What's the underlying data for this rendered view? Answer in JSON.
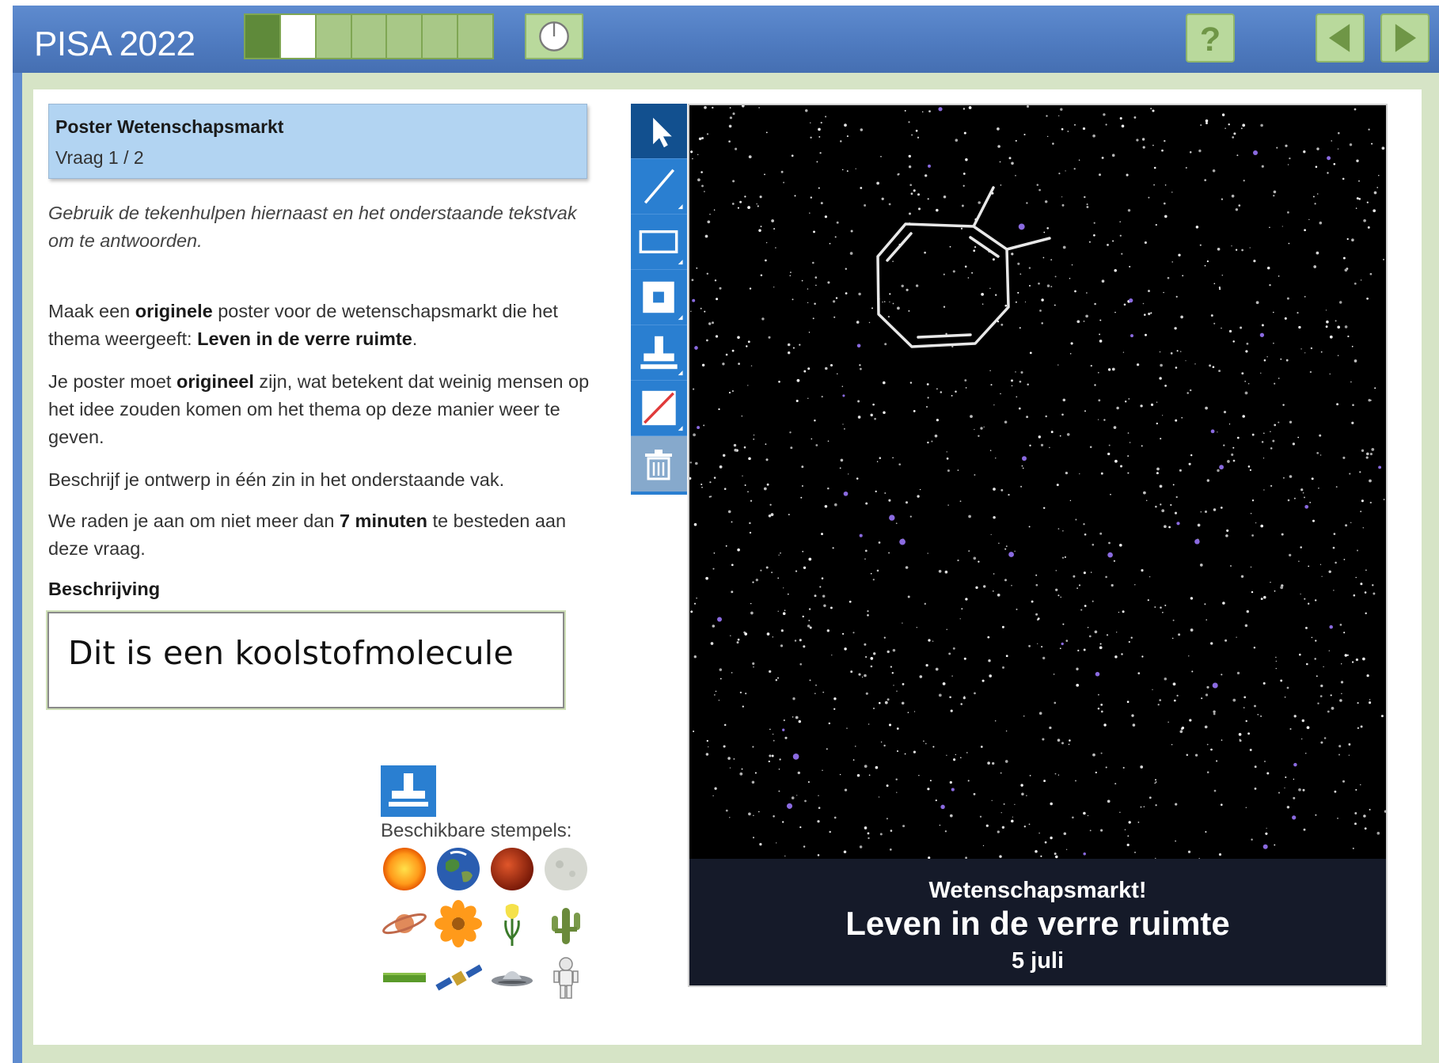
{
  "header": {
    "title": "PISA 2022",
    "progress": {
      "total_segments": 7,
      "completed": 1,
      "current": 2
    },
    "colors": {
      "bar": "#4f7bc0",
      "button": "#b9d99c"
    }
  },
  "question": {
    "title": "Poster Wetenschapsmarkt",
    "counter": "Vraag 1 / 2"
  },
  "instructions": "Gebruik de tekenhulpen hiernaast en het onderstaande tekstvak om te antwoorden.",
  "paragraphs": {
    "p1": {
      "a": "Maak een ",
      "b": "originele",
      "c": " poster voor de wetenschapsmarkt die het thema weergeeft: ",
      "d": "Leven in de verre ruimte",
      "e": "."
    },
    "p2": {
      "a": "Je poster moet ",
      "b": "origineel",
      "c": " zijn, wat betekent dat weinig mensen op het idee zouden komen om het thema op deze manier weer te geven."
    },
    "p3": "Beschrijf je ontwerp in één zin in het onderstaande vak.",
    "p4": {
      "a": "We raden je aan om niet meer dan ",
      "b": "7 minuten",
      "c": " te besteden aan deze vraag."
    }
  },
  "description": {
    "label": "Beschrijving",
    "value": "Dit is een koolstofmolecule"
  },
  "stamps": {
    "label": "Beschikbare stempels:",
    "items": [
      "sun",
      "earth",
      "mars",
      "moon",
      "saturn",
      "flower",
      "tulip",
      "cactus",
      "grass",
      "satellite",
      "ufo",
      "astronaut"
    ]
  },
  "toolbar": {
    "tools": [
      "select-arrow-icon",
      "line-icon",
      "rectangle-icon",
      "filled-square-icon",
      "stamp-icon",
      "eraser-icon",
      "trash-icon"
    ],
    "selected": "select-arrow-icon"
  },
  "poster": {
    "banner_top": "Wetenschapsmarkt!",
    "banner_main": "Leven in de verre ruimte",
    "banner_date": "5 juli"
  }
}
